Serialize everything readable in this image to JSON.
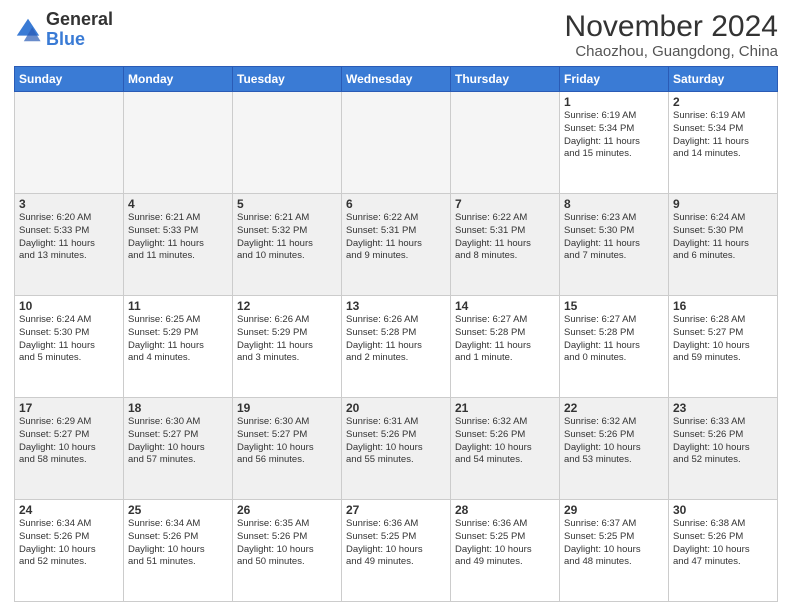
{
  "header": {
    "logo_general": "General",
    "logo_blue": "Blue",
    "month_title": "November 2024",
    "location": "Chaozhou, Guangdong, China"
  },
  "days_of_week": [
    "Sunday",
    "Monday",
    "Tuesday",
    "Wednesday",
    "Thursday",
    "Friday",
    "Saturday"
  ],
  "weeks": [
    [
      {
        "day": "",
        "info": "",
        "empty": true
      },
      {
        "day": "",
        "info": "",
        "empty": true
      },
      {
        "day": "",
        "info": "",
        "empty": true
      },
      {
        "day": "",
        "info": "",
        "empty": true
      },
      {
        "day": "",
        "info": "",
        "empty": true
      },
      {
        "day": "1",
        "info": "Sunrise: 6:19 AM\nSunset: 5:34 PM\nDaylight: 11 hours\nand 15 minutes."
      },
      {
        "day": "2",
        "info": "Sunrise: 6:19 AM\nSunset: 5:34 PM\nDaylight: 11 hours\nand 14 minutes."
      }
    ],
    [
      {
        "day": "3",
        "info": "Sunrise: 6:20 AM\nSunset: 5:33 PM\nDaylight: 11 hours\nand 13 minutes.",
        "shaded": true
      },
      {
        "day": "4",
        "info": "Sunrise: 6:21 AM\nSunset: 5:33 PM\nDaylight: 11 hours\nand 11 minutes.",
        "shaded": true
      },
      {
        "day": "5",
        "info": "Sunrise: 6:21 AM\nSunset: 5:32 PM\nDaylight: 11 hours\nand 10 minutes.",
        "shaded": true
      },
      {
        "day": "6",
        "info": "Sunrise: 6:22 AM\nSunset: 5:31 PM\nDaylight: 11 hours\nand 9 minutes.",
        "shaded": true
      },
      {
        "day": "7",
        "info": "Sunrise: 6:22 AM\nSunset: 5:31 PM\nDaylight: 11 hours\nand 8 minutes.",
        "shaded": true
      },
      {
        "day": "8",
        "info": "Sunrise: 6:23 AM\nSunset: 5:30 PM\nDaylight: 11 hours\nand 7 minutes.",
        "shaded": true
      },
      {
        "day": "9",
        "info": "Sunrise: 6:24 AM\nSunset: 5:30 PM\nDaylight: 11 hours\nand 6 minutes.",
        "shaded": true
      }
    ],
    [
      {
        "day": "10",
        "info": "Sunrise: 6:24 AM\nSunset: 5:30 PM\nDaylight: 11 hours\nand 5 minutes."
      },
      {
        "day": "11",
        "info": "Sunrise: 6:25 AM\nSunset: 5:29 PM\nDaylight: 11 hours\nand 4 minutes."
      },
      {
        "day": "12",
        "info": "Sunrise: 6:26 AM\nSunset: 5:29 PM\nDaylight: 11 hours\nand 3 minutes."
      },
      {
        "day": "13",
        "info": "Sunrise: 6:26 AM\nSunset: 5:28 PM\nDaylight: 11 hours\nand 2 minutes."
      },
      {
        "day": "14",
        "info": "Sunrise: 6:27 AM\nSunset: 5:28 PM\nDaylight: 11 hours\nand 1 minute."
      },
      {
        "day": "15",
        "info": "Sunrise: 6:27 AM\nSunset: 5:28 PM\nDaylight: 11 hours\nand 0 minutes."
      },
      {
        "day": "16",
        "info": "Sunrise: 6:28 AM\nSunset: 5:27 PM\nDaylight: 10 hours\nand 59 minutes."
      }
    ],
    [
      {
        "day": "17",
        "info": "Sunrise: 6:29 AM\nSunset: 5:27 PM\nDaylight: 10 hours\nand 58 minutes.",
        "shaded": true
      },
      {
        "day": "18",
        "info": "Sunrise: 6:30 AM\nSunset: 5:27 PM\nDaylight: 10 hours\nand 57 minutes.",
        "shaded": true
      },
      {
        "day": "19",
        "info": "Sunrise: 6:30 AM\nSunset: 5:27 PM\nDaylight: 10 hours\nand 56 minutes.",
        "shaded": true
      },
      {
        "day": "20",
        "info": "Sunrise: 6:31 AM\nSunset: 5:26 PM\nDaylight: 10 hours\nand 55 minutes.",
        "shaded": true
      },
      {
        "day": "21",
        "info": "Sunrise: 6:32 AM\nSunset: 5:26 PM\nDaylight: 10 hours\nand 54 minutes.",
        "shaded": true
      },
      {
        "day": "22",
        "info": "Sunrise: 6:32 AM\nSunset: 5:26 PM\nDaylight: 10 hours\nand 53 minutes.",
        "shaded": true
      },
      {
        "day": "23",
        "info": "Sunrise: 6:33 AM\nSunset: 5:26 PM\nDaylight: 10 hours\nand 52 minutes.",
        "shaded": true
      }
    ],
    [
      {
        "day": "24",
        "info": "Sunrise: 6:34 AM\nSunset: 5:26 PM\nDaylight: 10 hours\nand 52 minutes."
      },
      {
        "day": "25",
        "info": "Sunrise: 6:34 AM\nSunset: 5:26 PM\nDaylight: 10 hours\nand 51 minutes."
      },
      {
        "day": "26",
        "info": "Sunrise: 6:35 AM\nSunset: 5:26 PM\nDaylight: 10 hours\nand 50 minutes."
      },
      {
        "day": "27",
        "info": "Sunrise: 6:36 AM\nSunset: 5:25 PM\nDaylight: 10 hours\nand 49 minutes."
      },
      {
        "day": "28",
        "info": "Sunrise: 6:36 AM\nSunset: 5:25 PM\nDaylight: 10 hours\nand 49 minutes."
      },
      {
        "day": "29",
        "info": "Sunrise: 6:37 AM\nSunset: 5:25 PM\nDaylight: 10 hours\nand 48 minutes."
      },
      {
        "day": "30",
        "info": "Sunrise: 6:38 AM\nSunset: 5:26 PM\nDaylight: 10 hours\nand 47 minutes."
      }
    ]
  ]
}
